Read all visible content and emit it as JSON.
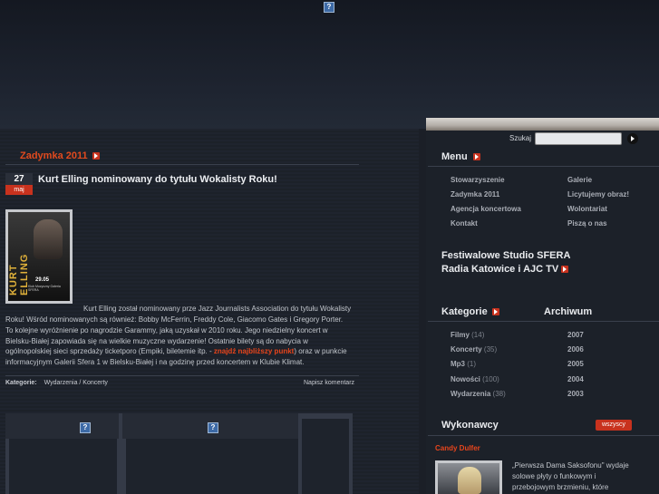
{
  "header": {
    "image_placeholder": "?"
  },
  "main": {
    "category_title": "Zadymka 2011",
    "date": {
      "day": "27",
      "month": "maj"
    },
    "post_title": "Kurt Elling nominowany do tytułu Wokalisty Roku!",
    "poster": {
      "name_line": "KURT ELLING",
      "date": "29.05",
      "venue": "Klub Muzyczny Galeria SFERA"
    },
    "body_first_line": "Kurt Elling został nominowany prze Jazz Journalists Association do tytułu Wokalisty",
    "body_lines": [
      "Roku! Wśród nominowanych są również: Bobby McFerrin, Freddy Cole, Giacomo Gates i Gregory Porter.",
      "To kolejne wyróżnienie po nagrodzie Garammy, jaką uzyskał w 2010 roku. Jego niedzielny koncert w",
      "Bielsku-Białej zapowiada się na wielkie muzyczne wydarzenie! Ostatnie bilety są do nabycia w"
    ],
    "body_line4_pre": "ogólnopolskiej sieci sprzedaży ticketporo (Empiki, biletemie itp. - ",
    "body_line4_link": "znajdź najbliższy punkt",
    "body_line4_post": ") oraz w punkcie",
    "body_line5": "informacyjnym Galerii Sfera 1 w Bielsku-Białej i na godzinę przed koncertem w Klubie Klimat.",
    "categories_label": "Kategorie:",
    "categories_value": "Wydarzenia / Koncerty",
    "comment_link": "Napisz komentarz"
  },
  "sidebar": {
    "search_label": "Szukaj",
    "search_value": "",
    "menu_title": "Menu",
    "menu_left": [
      "Stowarzyszenie",
      "Zadymka 2011",
      "Agencja koncertowa",
      "Kontakt"
    ],
    "menu_right": [
      "Galerie",
      "Licytujemy obraz!",
      "Wolontariat",
      "Piszą o nas"
    ],
    "studio_line1": "Festiwalowe Studio SFERA",
    "studio_line2": "Radia Katowice i AJC TV",
    "kategorie_title": "Kategorie",
    "archiwum_title": "Archiwum",
    "kategorie": [
      {
        "name": "Filmy",
        "count": "(14)"
      },
      {
        "name": "Koncerty",
        "count": "(35)"
      },
      {
        "name": "Mp3",
        "count": "(1)"
      },
      {
        "name": "Nowości",
        "count": "(100)"
      },
      {
        "name": "Wydarzenia",
        "count": "(38)"
      }
    ],
    "archiwum": [
      "2007",
      "2006",
      "2005",
      "2004",
      "2003"
    ],
    "wykonawcy_title": "Wykonawcy",
    "wszyscy_button": "wszyscy",
    "artist_name": "Candy Dulfer",
    "artist_desc": [
      "„Pierwsza Dama Saksofonu\" wydaje",
      "solowe płyty o funkowym i",
      "przebojowym brzmieniu, które"
    ]
  },
  "colors": {
    "accent": "#c8321e",
    "link_red": "#e8451c",
    "bg": "#1b1f27"
  }
}
